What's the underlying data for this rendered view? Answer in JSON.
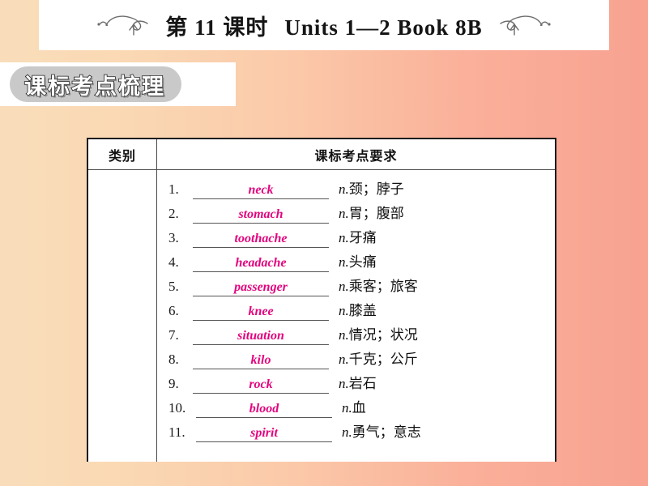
{
  "header": {
    "lesson_title": "第 11 课时",
    "unit_title": "Units 1—2 Book 8B",
    "left_flourish_icon": "flourish-swirl-icon",
    "right_flourish_icon": "flourish-swirl-icon"
  },
  "section_badge": {
    "label": "课标考点梳理"
  },
  "table": {
    "headers": {
      "category": "类别",
      "requirement": "课标考点要求"
    },
    "category_value": "",
    "rows": [
      {
        "num": "1.",
        "answer": "neck",
        "pos": "n.",
        "meaning": "颈；脖子"
      },
      {
        "num": "2.",
        "answer": "stomach",
        "pos": "n.",
        "meaning": "胃；腹部"
      },
      {
        "num": "3.",
        "answer": "toothache",
        "pos": "n.",
        "meaning": "牙痛"
      },
      {
        "num": "4.",
        "answer": "headache",
        "pos": "n.",
        "meaning": "头痛"
      },
      {
        "num": "5.",
        "answer": "passenger",
        "pos": "n.",
        "meaning": "乘客；旅客"
      },
      {
        "num": "6.",
        "answer": "knee",
        "pos": "n.",
        "meaning": "膝盖"
      },
      {
        "num": "7.",
        "answer": "situation",
        "pos": "n.",
        "meaning": "情况；状况"
      },
      {
        "num": "8.",
        "answer": "kilo",
        "pos": "n.",
        "meaning": "千克；公斤"
      },
      {
        "num": "9.",
        "answer": "rock",
        "pos": "n.",
        "meaning": "岩石"
      },
      {
        "num": "10.",
        "answer": "blood",
        "pos": "n.",
        "meaning": "血"
      },
      {
        "num": "11.",
        "answer": "spirit",
        "pos": "n.",
        "meaning": "勇气；意志"
      }
    ]
  },
  "colors": {
    "answer_pink": "#e2047e",
    "background_left": "#f9ddba",
    "background_right": "#f8a291",
    "badge_gray": "#c9c9c9",
    "table_border": "#1d1d1d"
  }
}
